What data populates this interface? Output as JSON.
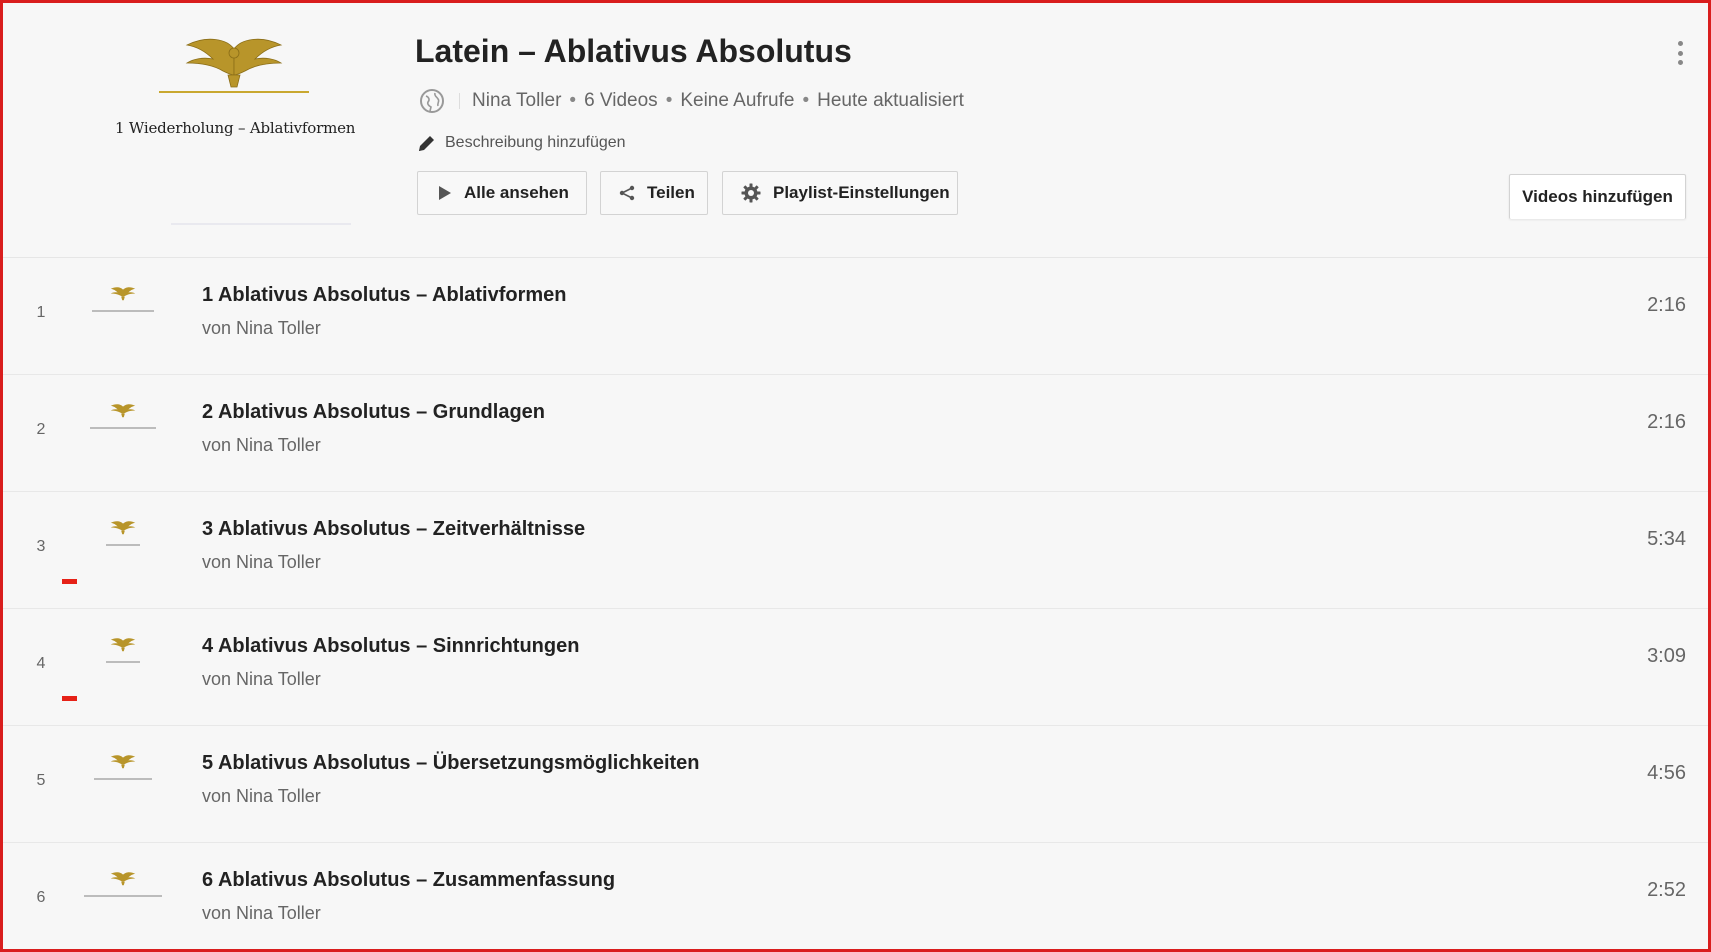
{
  "playlist": {
    "title": "Latein – Ablativus Absolutus",
    "owner": "Nina Toller",
    "video_count": "6 Videos",
    "views": "Keine Aufrufe",
    "updated": "Heute aktualisiert",
    "meta_separator": "•",
    "description_prompt": "Beschreibung hinzufügen",
    "thumbnail_caption": "1 Wiederholung – Ablativformen"
  },
  "actions": {
    "play_all": "Alle ansehen",
    "share": "Teilen",
    "settings": "Playlist-Einstellungen",
    "add_videos": "Videos hinzufügen"
  },
  "icons": {
    "privacy": "globe-icon",
    "edit": "pencil-icon",
    "play": "play-icon",
    "share": "share-icon",
    "settings": "gear-icon",
    "menu": "more-vertical-icon"
  },
  "colors": {
    "accent": "#e62117",
    "frame": "#d91e1e",
    "eagle_gold": "#b8952a"
  },
  "videos": [
    {
      "index": "1",
      "title": "1 Ablativus Absolutus – Ablativformen",
      "owner": "von Nina Toller",
      "duration": "2:16",
      "watched": false
    },
    {
      "index": "2",
      "title": "2 Ablativus Absolutus – Grundlagen",
      "owner": "von Nina Toller",
      "duration": "2:16",
      "watched": false
    },
    {
      "index": "3",
      "title": "3 Ablativus Absolutus – Zeitverhältnisse",
      "owner": "von Nina Toller",
      "duration": "5:34",
      "watched": true
    },
    {
      "index": "4",
      "title": "4 Ablativus Absolutus – Sinnrichtungen",
      "owner": "von Nina Toller",
      "duration": "3:09",
      "watched": true
    },
    {
      "index": "5",
      "title": "5 Ablativus Absolutus – Übersetzungsmöglichkeiten",
      "owner": "von Nina Toller",
      "duration": "4:56",
      "watched": false
    },
    {
      "index": "6",
      "title": "6 Ablativus Absolutus – Zusammenfassung",
      "owner": "von Nina Toller",
      "duration": "2:52",
      "watched": false
    }
  ]
}
